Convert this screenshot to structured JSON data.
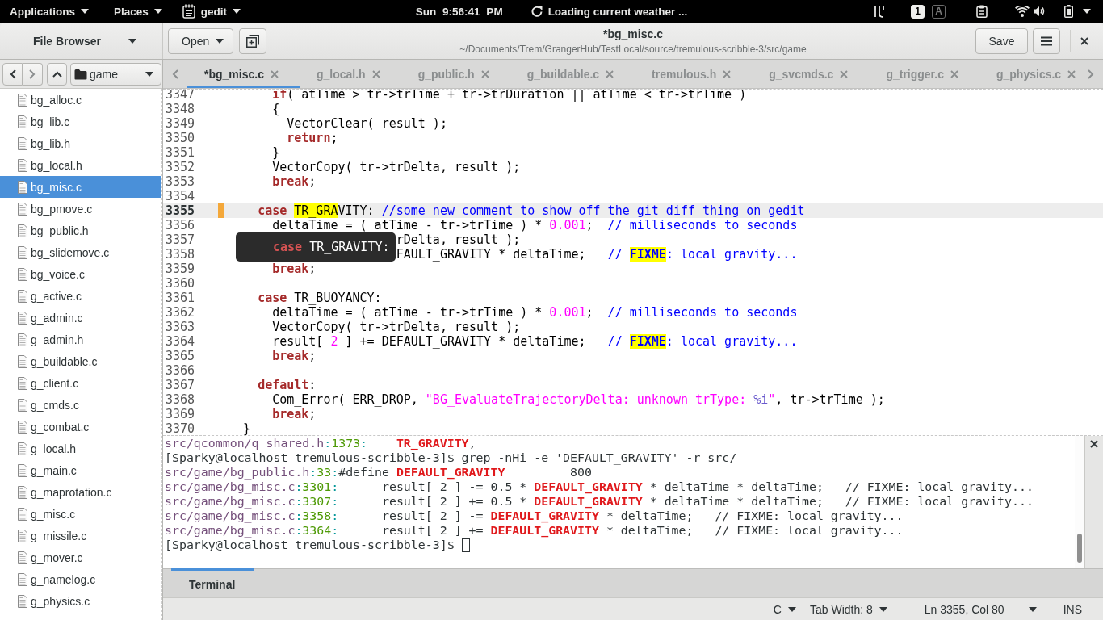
{
  "top_bar": {
    "applications_menu": "Applications",
    "places_menu": "Places",
    "app_menu": "gedit",
    "clock": "Sun 9:56:41 PM",
    "weather": "Loading current weather ...",
    "lock_keys": [
      {
        "label": "1",
        "on": true
      },
      {
        "label": "A",
        "on": false
      }
    ]
  },
  "header_bar": {
    "side_panel": "File Browser",
    "open_button": "Open",
    "title": "*bg_misc.c",
    "subtitle": "~/Documents/Trem/GrangerHub/TestLocal/source/tremulous-scribble-3/src/game",
    "save_button": "Save"
  },
  "file_browser": {
    "folder": "game",
    "items": [
      {
        "name": "bg_alloc.c",
        "selected": false
      },
      {
        "name": "bg_lib.c",
        "selected": false
      },
      {
        "name": "bg_lib.h",
        "selected": false
      },
      {
        "name": "bg_local.h",
        "selected": false
      },
      {
        "name": "bg_misc.c",
        "selected": true
      },
      {
        "name": "bg_pmove.c",
        "selected": false
      },
      {
        "name": "bg_public.h",
        "selected": false
      },
      {
        "name": "bg_slidemove.c",
        "selected": false
      },
      {
        "name": "bg_voice.c",
        "selected": false
      },
      {
        "name": "g_active.c",
        "selected": false
      },
      {
        "name": "g_admin.c",
        "selected": false
      },
      {
        "name": "g_admin.h",
        "selected": false
      },
      {
        "name": "g_buildable.c",
        "selected": false
      },
      {
        "name": "g_client.c",
        "selected": false
      },
      {
        "name": "g_cmds.c",
        "selected": false
      },
      {
        "name": "g_combat.c",
        "selected": false
      },
      {
        "name": "g_local.h",
        "selected": false
      },
      {
        "name": "g_main.c",
        "selected": false
      },
      {
        "name": "g_maprotation.c",
        "selected": false
      },
      {
        "name": "g_misc.c",
        "selected": false
      },
      {
        "name": "g_missile.c",
        "selected": false
      },
      {
        "name": "g_mover.c",
        "selected": false
      },
      {
        "name": "g_namelog.c",
        "selected": false
      },
      {
        "name": "g_physics.c",
        "selected": false
      }
    ]
  },
  "tabs": [
    {
      "label": "*bg_misc.c",
      "selected": true
    },
    {
      "label": "g_local.h",
      "selected": false
    },
    {
      "label": "g_public.h",
      "selected": false
    },
    {
      "label": "g_buildable.c",
      "selected": false
    },
    {
      "label": "tremulous.h",
      "selected": false
    },
    {
      "label": "g_svcmds.c",
      "selected": false
    },
    {
      "label": "g_trigger.c",
      "selected": false
    },
    {
      "label": "g_physics.c",
      "selected": false
    }
  ],
  "editor": {
    "lines": [
      {
        "number": "3347",
        "current": false,
        "changed": false,
        "segments": [
          {
            "kind": "keyword",
            "text": "      if"
          },
          {
            "kind": "plain",
            "text": "( atTime > tr->trTime + tr->trDuration || atTime < tr->trTime )"
          }
        ]
      },
      {
        "number": "3348",
        "current": false,
        "changed": false,
        "segments": [
          {
            "kind": "plain",
            "text": "      {"
          }
        ]
      },
      {
        "number": "3349",
        "current": false,
        "changed": false,
        "segments": [
          {
            "kind": "plain",
            "text": "        VectorClear( result );"
          }
        ]
      },
      {
        "number": "3350",
        "current": false,
        "changed": false,
        "segments": [
          {
            "kind": "keyword",
            "text": "        return"
          },
          {
            "kind": "plain",
            "text": ";"
          }
        ]
      },
      {
        "number": "3351",
        "current": false,
        "changed": false,
        "segments": [
          {
            "kind": "plain",
            "text": "      }"
          }
        ]
      },
      {
        "number": "3352",
        "current": false,
        "changed": false,
        "segments": [
          {
            "kind": "plain",
            "text": "      VectorCopy( tr->trDelta, result );"
          }
        ]
      },
      {
        "number": "3353",
        "current": false,
        "changed": false,
        "segments": [
          {
            "kind": "keyword",
            "text": "      break"
          },
          {
            "kind": "plain",
            "text": ";"
          }
        ]
      },
      {
        "number": "3354",
        "current": false,
        "changed": false
      },
      {
        "number": "3355",
        "current": true,
        "changed": true,
        "segments": [
          {
            "kind": "keyword",
            "text": "    case "
          },
          {
            "kind": "match",
            "text": "TR_GRA"
          },
          {
            "kind": "plain",
            "text": "VITY: "
          },
          {
            "kind": "comment",
            "text": "//some new comment to show off the git diff thing on gedit"
          }
        ]
      },
      {
        "number": "3356",
        "current": false,
        "changed": false,
        "segments": [
          {
            "kind": "plain",
            "text": "      deltaTime = ( atTime - tr->trTime ) * "
          },
          {
            "kind": "number",
            "text": "0.001"
          },
          {
            "kind": "plain",
            "text": ";  "
          },
          {
            "kind": "comment",
            "text": "// milliseconds to seconds"
          }
        ]
      },
      {
        "number": "3357",
        "current": false,
        "changed": false,
        "segments": [
          {
            "kind": "plain",
            "text": "                       rDelta, result );"
          }
        ]
      },
      {
        "number": "3358",
        "current": false,
        "changed": false,
        "segments": [
          {
            "kind": "plain",
            "text": "                       FAULT_GRAVITY * deltaTime;   "
          },
          {
            "kind": "comment",
            "text": "// "
          },
          {
            "kind": "todo",
            "text": "FIXME"
          },
          {
            "kind": "comment",
            "text": ": local gravity..."
          }
        ]
      },
      {
        "number": "3359",
        "current": false,
        "changed": false,
        "segments": [
          {
            "kind": "keyword",
            "text": "      break"
          },
          {
            "kind": "plain",
            "text": ";"
          }
        ]
      },
      {
        "number": "3360",
        "current": false,
        "changed": false
      },
      {
        "number": "3361",
        "current": false,
        "changed": false,
        "segments": [
          {
            "kind": "keyword",
            "text": "    case"
          },
          {
            "kind": "plain",
            "text": " TR_BUOYANCY:"
          }
        ]
      },
      {
        "number": "3362",
        "current": false,
        "changed": false,
        "segments": [
          {
            "kind": "plain",
            "text": "      deltaTime = ( atTime - tr->trTime ) * "
          },
          {
            "kind": "number",
            "text": "0.001"
          },
          {
            "kind": "plain",
            "text": ";  "
          },
          {
            "kind": "comment",
            "text": "// milliseconds to seconds"
          }
        ]
      },
      {
        "number": "3363",
        "current": false,
        "changed": false,
        "segments": [
          {
            "kind": "plain",
            "text": "      VectorCopy( tr->trDelta, result );"
          }
        ]
      },
      {
        "number": "3364",
        "current": false,
        "changed": false,
        "segments": [
          {
            "kind": "plain",
            "text": "      result[ "
          },
          {
            "kind": "number",
            "text": "2"
          },
          {
            "kind": "plain",
            "text": " ] += DEFAULT_GRAVITY * deltaTime;   "
          },
          {
            "kind": "comment",
            "text": "// "
          },
          {
            "kind": "todo",
            "text": "FIXME"
          },
          {
            "kind": "comment",
            "text": ": local gravity..."
          }
        ]
      },
      {
        "number": "3365",
        "current": false,
        "changed": false,
        "segments": [
          {
            "kind": "keyword",
            "text": "      break"
          },
          {
            "kind": "plain",
            "text": ";"
          }
        ]
      },
      {
        "number": "3366",
        "current": false,
        "changed": false
      },
      {
        "number": "3367",
        "current": false,
        "changed": false,
        "segments": [
          {
            "kind": "keyword",
            "text": "    default"
          },
          {
            "kind": "plain",
            "text": ":"
          }
        ]
      },
      {
        "number": "3368",
        "current": false,
        "changed": false,
        "segments": [
          {
            "kind": "plain",
            "text": "      Com_Error( ERR_DROP, "
          },
          {
            "kind": "string",
            "text": "\"BG_EvaluateTrajectoryDelta: unknown trType: "
          },
          {
            "kind": "format",
            "text": "%i"
          },
          {
            "kind": "string",
            "text": "\""
          },
          {
            "kind": "plain",
            "text": ", tr->trTime );"
          }
        ]
      },
      {
        "number": "3369",
        "current": false,
        "changed": false,
        "segments": [
          {
            "kind": "keyword",
            "text": "      break"
          },
          {
            "kind": "plain",
            "text": ";"
          }
        ]
      },
      {
        "number": "3370",
        "current": false,
        "changed": false,
        "segments": [
          {
            "kind": "plain",
            "text": "  }"
          }
        ]
      }
    ]
  },
  "tooltip": {
    "segments": [
      {
        "kind": "keyword",
        "text": "case"
      },
      {
        "kind": "plain",
        "text": " TR_GRAVITY:"
      }
    ]
  },
  "terminal": {
    "lines": [
      {
        "segments": [
          {
            "kind": "path",
            "text": "src/qcommon/q_shared.h"
          },
          {
            "kind": "separator",
            "text": ":"
          },
          {
            "kind": "line_number",
            "text": "1373"
          },
          {
            "kind": "separator",
            "text": ":"
          },
          {
            "kind": "match",
            "text": "    TR_GRAVITY"
          },
          {
            "kind": "plain",
            "text": ","
          }
        ]
      },
      {
        "segments": [
          {
            "kind": "plain",
            "text": "[Sparky@localhost tremulous-scribble-3]$ grep -nHi -e 'DEFAULT_GRAVITY' -r src/"
          }
        ]
      },
      {
        "segments": [
          {
            "kind": "path",
            "text": "src/game/bg_public.h"
          },
          {
            "kind": "separator",
            "text": ":"
          },
          {
            "kind": "line_number",
            "text": "33"
          },
          {
            "kind": "separator",
            "text": ":"
          },
          {
            "kind": "plain",
            "text": "#define "
          },
          {
            "kind": "match",
            "text": "DEFAULT_GRAVITY"
          },
          {
            "kind": "plain",
            "text": "         800"
          }
        ]
      },
      {
        "segments": [
          {
            "kind": "path",
            "text": "src/game/bg_misc.c"
          },
          {
            "kind": "separator",
            "text": ":"
          },
          {
            "kind": "line_number",
            "text": "3301"
          },
          {
            "kind": "separator",
            "text": ":"
          },
          {
            "kind": "plain",
            "text": "      result[ 2 ] -= 0.5 * "
          },
          {
            "kind": "match",
            "text": "DEFAULT_GRAVITY"
          },
          {
            "kind": "plain",
            "text": " * deltaTime * deltaTime;   // FIXME: local gravity..."
          }
        ]
      },
      {
        "segments": [
          {
            "kind": "path",
            "text": "src/game/bg_misc.c"
          },
          {
            "kind": "separator",
            "text": ":"
          },
          {
            "kind": "line_number",
            "text": "3307"
          },
          {
            "kind": "separator",
            "text": ":"
          },
          {
            "kind": "plain",
            "text": "      result[ 2 ] += 0.5 * "
          },
          {
            "kind": "match",
            "text": "DEFAULT_GRAVITY"
          },
          {
            "kind": "plain",
            "text": " * deltaTime * deltaTime;   // FIXME: local gravity..."
          }
        ]
      },
      {
        "segments": [
          {
            "kind": "path",
            "text": "src/game/bg_misc.c"
          },
          {
            "kind": "separator",
            "text": ":"
          },
          {
            "kind": "line_number",
            "text": "3358"
          },
          {
            "kind": "separator",
            "text": ":"
          },
          {
            "kind": "plain",
            "text": "      result[ 2 ] -= "
          },
          {
            "kind": "match",
            "text": "DEFAULT_GRAVITY"
          },
          {
            "kind": "plain",
            "text": " * deltaTime;   // FIXME: local gravity..."
          }
        ]
      },
      {
        "segments": [
          {
            "kind": "path",
            "text": "src/game/bg_misc.c"
          },
          {
            "kind": "separator",
            "text": ":"
          },
          {
            "kind": "line_number",
            "text": "3364"
          },
          {
            "kind": "separator",
            "text": ":"
          },
          {
            "kind": "plain",
            "text": "      result[ 2 ] += "
          },
          {
            "kind": "match",
            "text": "DEFAULT_GRAVITY"
          },
          {
            "kind": "plain",
            "text": " * deltaTime;   // FIXME: local gravity..."
          }
        ]
      },
      {
        "segments": [
          {
            "kind": "plain",
            "text": "[Sparky@localhost tremulous-scribble-3]$"
          }
        ]
      }
    ]
  },
  "bottom_panel": {
    "tabs": [
      {
        "label": "Terminal",
        "selected": true
      }
    ]
  },
  "status_bar": {
    "language": "C",
    "tab_width": "Tab Width: 8",
    "position": "Ln 3355, Col 80",
    "mode": "INS"
  }
}
